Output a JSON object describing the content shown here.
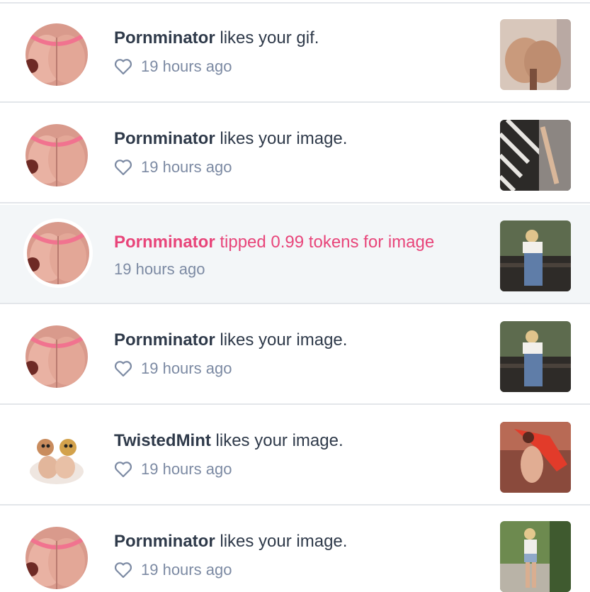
{
  "notifications": [
    {
      "user": "Pornminator",
      "action": "likes your gif.",
      "time": "19 hours ago",
      "icon": "heart-icon",
      "avatar": "avatar-peach",
      "thumb": "thumb-1",
      "highlight": false
    },
    {
      "user": "Pornminator",
      "action": "likes your image.",
      "time": "19 hours ago",
      "icon": "heart-icon",
      "avatar": "avatar-peach",
      "thumb": "thumb-2",
      "highlight": false
    },
    {
      "user": "Pornminator",
      "action": "tipped 0.99 tokens for image",
      "time": "19 hours ago",
      "icon": "",
      "avatar": "avatar-peach",
      "thumb": "thumb-3",
      "highlight": true
    },
    {
      "user": "Pornminator",
      "action": "likes your image.",
      "time": "19 hours ago",
      "icon": "heart-icon",
      "avatar": "avatar-peach",
      "thumb": "thumb-3",
      "highlight": false
    },
    {
      "user": "TwistedMint",
      "action": "likes your image.",
      "time": "19 hours ago",
      "icon": "heart-icon",
      "avatar": "avatar-figures",
      "thumb": "thumb-4",
      "highlight": false
    },
    {
      "user": "Pornminator",
      "action": "likes your image.",
      "time": "19 hours ago",
      "icon": "heart-icon",
      "avatar": "avatar-peach",
      "thumb": "thumb-5",
      "highlight": false
    }
  ],
  "colors": {
    "highlight_bg": "#f3f6f8",
    "highlight_text": "#e8457a",
    "primary_text": "#2f3a4a",
    "secondary_text": "#7c8aa3"
  }
}
